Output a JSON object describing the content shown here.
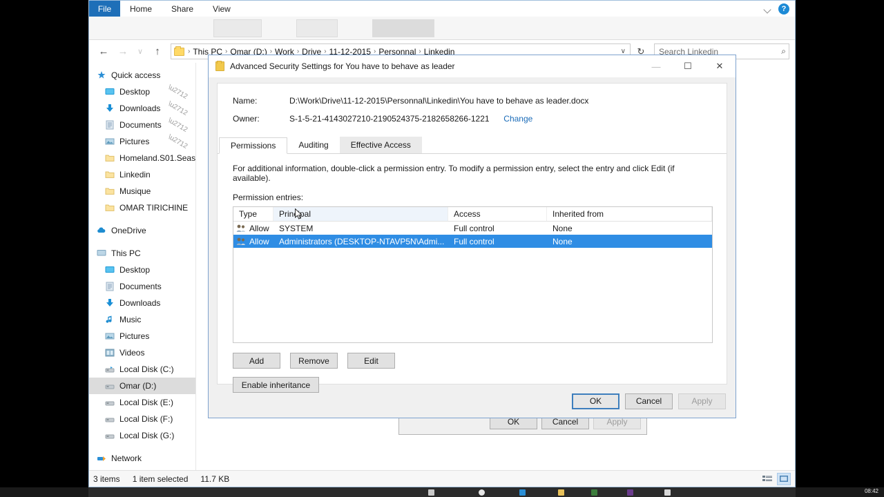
{
  "explorer": {
    "ribbon": {
      "file_tab": "File",
      "tabs": [
        "Home",
        "Share",
        "View"
      ],
      "collapse_icon": "chevron-down-icon",
      "help_icon": "help-icon",
      "help_glyph": "?"
    },
    "address": {
      "back_glyph": "←",
      "forward_glyph": "→",
      "recent_glyph": "∨",
      "up_glyph": "↑",
      "crumbs": [
        "This PC",
        "Omar (D:)",
        "Work",
        "Drive",
        "11-12-2015",
        "Personnal",
        "Linkedin"
      ],
      "separator": "›",
      "dropdown_glyph": "∨",
      "refresh_glyph": "↻",
      "search_placeholder": "Search Linkedin",
      "search_value": "",
      "search_icon_glyph": "⌕"
    },
    "nav_pane": {
      "quick_access": {
        "label": "Quick access",
        "icon": "star-icon"
      },
      "quick_items": [
        {
          "label": "Desktop",
          "icon": "desktop-icon",
          "pinned": true
        },
        {
          "label": "Downloads",
          "icon": "downloads-icon",
          "pinned": true
        },
        {
          "label": "Documents",
          "icon": "documents-icon",
          "pinned": true
        },
        {
          "label": "Pictures",
          "icon": "pictures-icon",
          "pinned": true
        },
        {
          "label": "Homeland.S01.Seas",
          "icon": "folder-icon",
          "pinned": false
        },
        {
          "label": "Linkedin",
          "icon": "folder-icon",
          "pinned": false
        },
        {
          "label": "Musique",
          "icon": "folder-icon",
          "pinned": false
        },
        {
          "label": "OMAR TIRICHINE",
          "icon": "folder-icon",
          "pinned": false
        }
      ],
      "onedrive": {
        "label": "OneDrive",
        "icon": "cloud-icon"
      },
      "this_pc": {
        "label": "This PC",
        "icon": "computer-icon"
      },
      "pc_items": [
        {
          "label": "Desktop",
          "icon": "desktop-icon",
          "selected": false
        },
        {
          "label": "Documents",
          "icon": "documents-icon",
          "selected": false
        },
        {
          "label": "Downloads",
          "icon": "downloads-icon",
          "selected": false
        },
        {
          "label": "Music",
          "icon": "music-icon",
          "selected": false
        },
        {
          "label": "Pictures",
          "icon": "pictures-icon",
          "selected": false
        },
        {
          "label": "Videos",
          "icon": "videos-icon",
          "selected": false
        },
        {
          "label": "Local Disk (C:)",
          "icon": "system-drive-icon",
          "selected": false
        },
        {
          "label": "Omar (D:)",
          "icon": "drive-icon",
          "selected": true
        },
        {
          "label": "Local Disk (E:)",
          "icon": "drive-icon",
          "selected": false
        },
        {
          "label": "Local Disk (F:)",
          "icon": "drive-icon",
          "selected": false
        },
        {
          "label": "Local Disk (G:)",
          "icon": "drive-icon",
          "selected": false
        }
      ],
      "network": {
        "label": "Network",
        "icon": "network-icon"
      }
    },
    "status": {
      "item_count": "3 items",
      "selection": "1 item selected",
      "size": "11.7 KB",
      "details_view_icon": "details-view-icon",
      "tiles_view_icon": "large-icons-view-icon"
    }
  },
  "parent_dialog": {
    "buttons": [
      {
        "label": "OK",
        "disabled": false
      },
      {
        "label": "Cancel",
        "disabled": false
      },
      {
        "label": "Apply",
        "disabled": true
      }
    ]
  },
  "advanced_security": {
    "title": "Advanced Security Settings for You have to behave as leader",
    "title_icon": "folder-icon",
    "window_controls": {
      "minimize": "—",
      "maximize": "☐",
      "close": "✕"
    },
    "name_label": "Name:",
    "name_value": "D:\\Work\\Drive\\11-12-2015\\Personnal\\Linkedin\\You have to behave as leader.docx",
    "owner_label": "Owner:",
    "owner_value": "S-1-5-21-4143027210-2190524375-2182658266-1221",
    "owner_change_link": "Change",
    "tabs": [
      {
        "label": "Permissions",
        "active": true
      },
      {
        "label": "Auditing",
        "active": false
      },
      {
        "label": "Effective Access",
        "active": false
      }
    ],
    "description": "For additional information, double-click a permission entry. To modify a permission entry, select the entry and click Edit (if available).",
    "entries_label": "Permission entries:",
    "grid": {
      "columns": [
        "Type",
        "Principal",
        "Access",
        "Inherited from"
      ],
      "rows": [
        {
          "icon": "users-icon",
          "type": "Allow",
          "principal": "SYSTEM",
          "access": "Full control",
          "inherited_from": "None",
          "selected": false
        },
        {
          "icon": "users-icon",
          "type": "Allow",
          "principal": "Administrators (DESKTOP-NTAVP5N\\Admi...",
          "access": "Full control",
          "inherited_from": "None",
          "selected": true
        }
      ]
    },
    "action_buttons": [
      {
        "label": "Add",
        "disabled": false
      },
      {
        "label": "Remove",
        "disabled": false
      },
      {
        "label": "Edit",
        "disabled": false
      }
    ],
    "inheritance_button": {
      "label": "Enable inheritance",
      "disabled": false
    },
    "footer_buttons": [
      {
        "label": "OK",
        "disabled": false,
        "default": true
      },
      {
        "label": "Cancel",
        "disabled": false,
        "default": false
      },
      {
        "label": "Apply",
        "disabled": true,
        "default": false
      }
    ]
  },
  "taskbar": {
    "clock": "08:42"
  },
  "colors": {
    "accent": "#1e6fb8",
    "selection": "#2f8de4",
    "link": "#1a6bb8",
    "folder": "#ffd966"
  }
}
